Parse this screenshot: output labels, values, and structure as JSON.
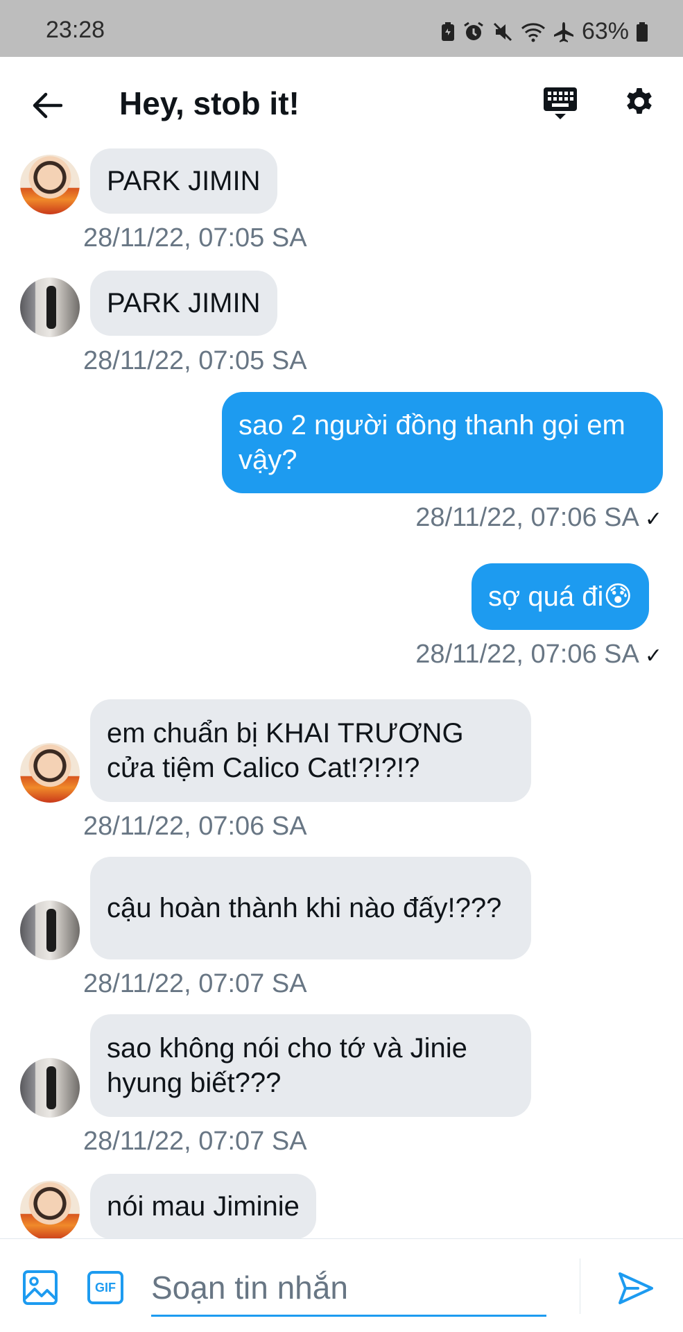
{
  "status_bar": {
    "time": "23:28",
    "battery": "63%",
    "icons": [
      "battery-saver-icon",
      "alarm-icon",
      "mute-icon",
      "wifi-icon",
      "airplane-icon",
      "battery-icon"
    ]
  },
  "header": {
    "title": "Hey, stob it!",
    "back_icon": "arrow-left-icon",
    "keyboard_icon": "keyboard-icon",
    "settings_icon": "gear-icon"
  },
  "messages": [
    {
      "direction": "in",
      "avatar": "a",
      "text": "PARK JIMIN",
      "time": "28/11/22, 07:05 SA"
    },
    {
      "direction": "in",
      "avatar": "b",
      "text": "PARK JIMIN",
      "time": "28/11/22, 07:05 SA"
    },
    {
      "direction": "out",
      "text": "sao 2 người đồng thanh gọi em vậy?",
      "time": "28/11/22, 07:06 SA",
      "check": "✓"
    },
    {
      "direction": "out",
      "text": "sợ quá đi😰",
      "time": "28/11/22, 07:06 SA",
      "check": "✓"
    },
    {
      "direction": "in",
      "avatar": "a",
      "text": "em chuẩn bị KHAI TRƯƠNG cửa tiệm Calico Cat!?!?!?",
      "time": "28/11/22, 07:06 SA"
    },
    {
      "direction": "in",
      "avatar": "b",
      "text": "cậu hoàn thành khi nào đấy!???",
      "time": "28/11/22, 07:07 SA"
    },
    {
      "direction": "in",
      "avatar": "b",
      "text": "sao không nói cho tớ và Jinie hyung biết???",
      "time": "28/11/22, 07:07 SA"
    },
    {
      "direction": "in",
      "avatar": "a",
      "text": "nói mau Jiminie",
      "time": ""
    }
  ],
  "composer": {
    "placeholder": "Soạn tin nhắn",
    "gif_label": "GIF",
    "image_icon": "image-icon",
    "send_icon": "send-icon"
  },
  "colors": {
    "accent": "#1d9bf0",
    "incoming_bubble": "#e7eaee",
    "timestamp": "#687684",
    "status_bar": "#bdbdbd"
  }
}
